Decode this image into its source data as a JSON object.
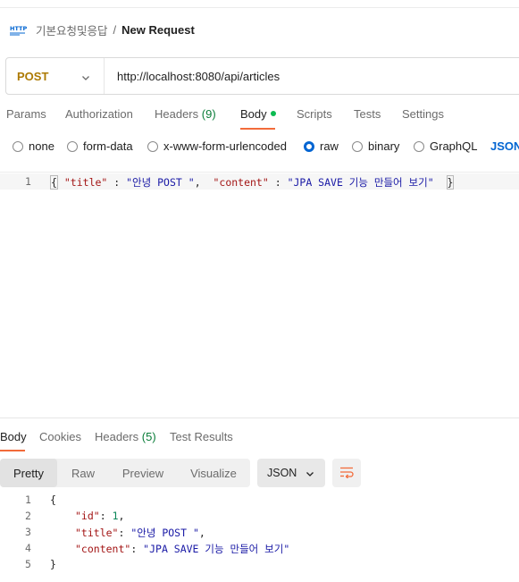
{
  "breadcrumb": {
    "icon": "http-icon",
    "parent": "기본요청및응답",
    "separator": "/",
    "title": "New Request"
  },
  "request": {
    "method": "POST",
    "url": "http://localhost:8080/api/articles",
    "tabs": [
      {
        "label": "Params"
      },
      {
        "label": "Authorization"
      },
      {
        "label": "Headers",
        "count": "(9)"
      },
      {
        "label": "Body",
        "active": true
      },
      {
        "label": "Scripts"
      },
      {
        "label": "Tests"
      },
      {
        "label": "Settings"
      }
    ],
    "body_types": [
      "none",
      "form-data",
      "x-www-form-urlencoded",
      "raw",
      "binary",
      "GraphQL"
    ],
    "selected_body_type": "raw",
    "language": "JSON",
    "editor": {
      "line_number": "1",
      "open_brace": "{",
      "title_key": "\"title\"",
      "colon1": " : ",
      "title_value": "\"안녕 POST \"",
      "comma": ",  ",
      "content_key": "\"content\"",
      "colon2": " : ",
      "content_value": "\"JPA SAVE 기능 만들어 보기\"",
      "close_brace": "}"
    }
  },
  "response": {
    "tabs": [
      {
        "label": "Body",
        "active": true
      },
      {
        "label": "Cookies"
      },
      {
        "label": "Headers",
        "count": "(5)"
      },
      {
        "label": "Test Results"
      }
    ],
    "views": [
      "Pretty",
      "Raw",
      "Preview",
      "Visualize"
    ],
    "selected_view": "Pretty",
    "format": "JSON",
    "lines": [
      {
        "n": "1",
        "text": "{"
      },
      {
        "n": "2",
        "key": "\"id\"",
        "sep": ": ",
        "value": "1",
        "vtype": "num",
        "trail": ","
      },
      {
        "n": "3",
        "key": "\"title\"",
        "sep": ": ",
        "value": "\"안녕 POST \"",
        "vtype": "str",
        "trail": ","
      },
      {
        "n": "4",
        "key": "\"content\"",
        "sep": ": ",
        "value": "\"JPA SAVE 기능 만들어 보기\"",
        "vtype": "str",
        "trail": ""
      },
      {
        "n": "5",
        "text": "}"
      }
    ]
  },
  "colors": {
    "accent_orange": "#f26b3a",
    "post_method": "#ad7a03",
    "link_blue": "#0265d2",
    "status_green": "#0cbb52"
  }
}
